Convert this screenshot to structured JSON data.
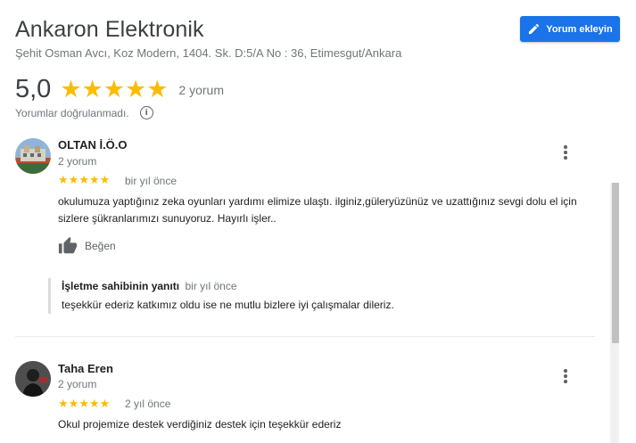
{
  "business": {
    "name": "Ankaron Elektronik",
    "address": "Şehit Osman Avcı, Koz Modern, 1404. Sk. D:5/A No : 36, Etimesgut/Ankara"
  },
  "add_review_button": {
    "label": "Yorum ekleyin",
    "icon": "pencil-icon"
  },
  "rating_summary": {
    "rating": "5,0",
    "stars": 5,
    "count_label": "2 yorum",
    "unverified_label": "Yorumlar doğrulanmadı.",
    "info_icon_glyph": "i"
  },
  "reviews": [
    {
      "name": "OLTAN İ.Ö.O",
      "meta": "2 yorum",
      "stars": 5,
      "time": "bir yıl önce",
      "text": "okulumuza yaptığınız zeka oyunları yardımı elimize ulaştı. ilginiz,güleryüzünüz ve uzattığınız sevgi dolu el için sizlere şükranlarımızı sunuyoruz. Hayırlı işler..",
      "like_label": "Beğen",
      "owner_reply": {
        "title": "İşletme sahibinin yanıtı",
        "time": "bir yıl önce",
        "text": "teşekkür ederiz katkımız oldu ise ne mutlu bizlere iyi çalışmalar dileriz."
      }
    },
    {
      "name": "Taha Eren",
      "meta": "2 yorum",
      "stars": 5,
      "time": "2 yıl önce",
      "text": "Okul projemize destek verdiğiniz destek için teşekkür ederiz"
    }
  ],
  "colors": {
    "accent": "#1a73e8",
    "star": "#fbbc04",
    "muted": "#70757a"
  }
}
